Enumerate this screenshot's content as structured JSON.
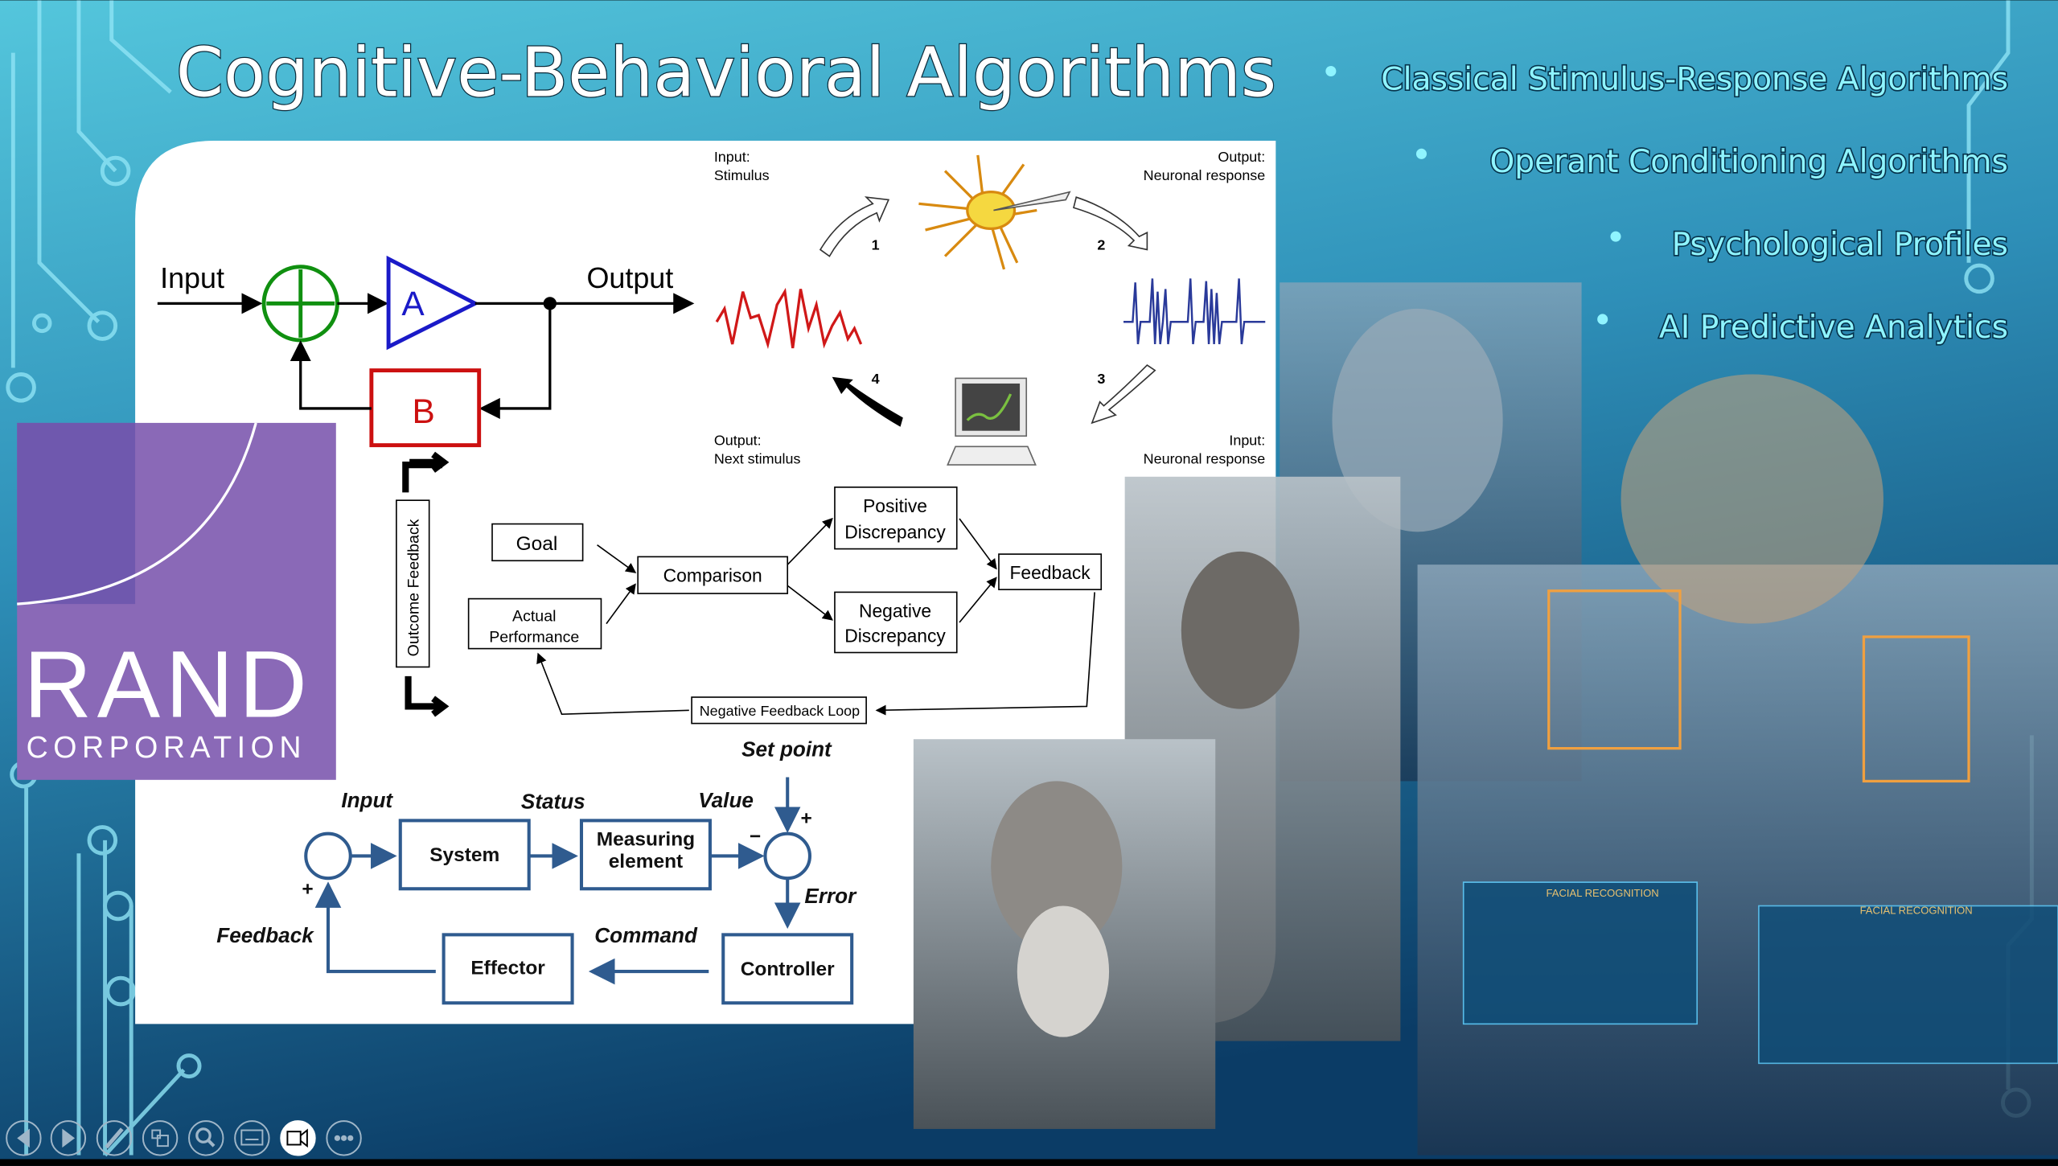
{
  "slide": {
    "title": "Cognitive-Behavioral Algorithms",
    "bullets": [
      "Classical Stimulus-Response Algorithms",
      "Operant Conditioning Algorithms",
      "Psychological Profiles",
      "AI Predictive Analytics"
    ]
  },
  "logo": {
    "name": "RAND",
    "sub": "CORPORATION",
    "color": "#8a69b7"
  },
  "control_loop": {
    "input": "Input",
    "output": "Output",
    "amp": "A",
    "feedback_block": "B"
  },
  "neuron_cycle": {
    "input_stimulus": [
      "Input:",
      "Stimulus"
    ],
    "output_neuronal": [
      "Output:",
      "Neuronal response"
    ],
    "output_next": [
      "Output:",
      "Next stimulus"
    ],
    "input_neuronal": [
      "Input:",
      "Neuronal response"
    ],
    "steps": [
      "1",
      "2",
      "3",
      "4"
    ]
  },
  "flowchart": {
    "outcome_feedback": "Outcome Feedback",
    "goal": "Goal",
    "actual": [
      "Actual",
      "Performance"
    ],
    "comparison": "Comparison",
    "positive": [
      "Positive",
      "Discrepancy"
    ],
    "negative": [
      "Negative",
      "Discrepancy"
    ],
    "feedback": "Feedback",
    "loop": "Negative Feedback Loop"
  },
  "feedback_system": {
    "set_point": "Set point",
    "input": "Input",
    "status": "Status",
    "value": "Value",
    "error": "Error",
    "command": "Command",
    "feedback": "Feedback",
    "system": "System",
    "measuring": [
      "Measuring",
      "element"
    ],
    "controller": "Controller",
    "effector": "Effector",
    "plus": "+",
    "minus": "−"
  },
  "overlays": {
    "facial_recognition": "FACIAL RECOGNITION"
  },
  "controls": [
    "previous-icon",
    "next-icon",
    "pen-icon",
    "slides-grid-icon",
    "zoom-icon",
    "subtitles-icon",
    "camera-icon",
    "more-icon"
  ]
}
